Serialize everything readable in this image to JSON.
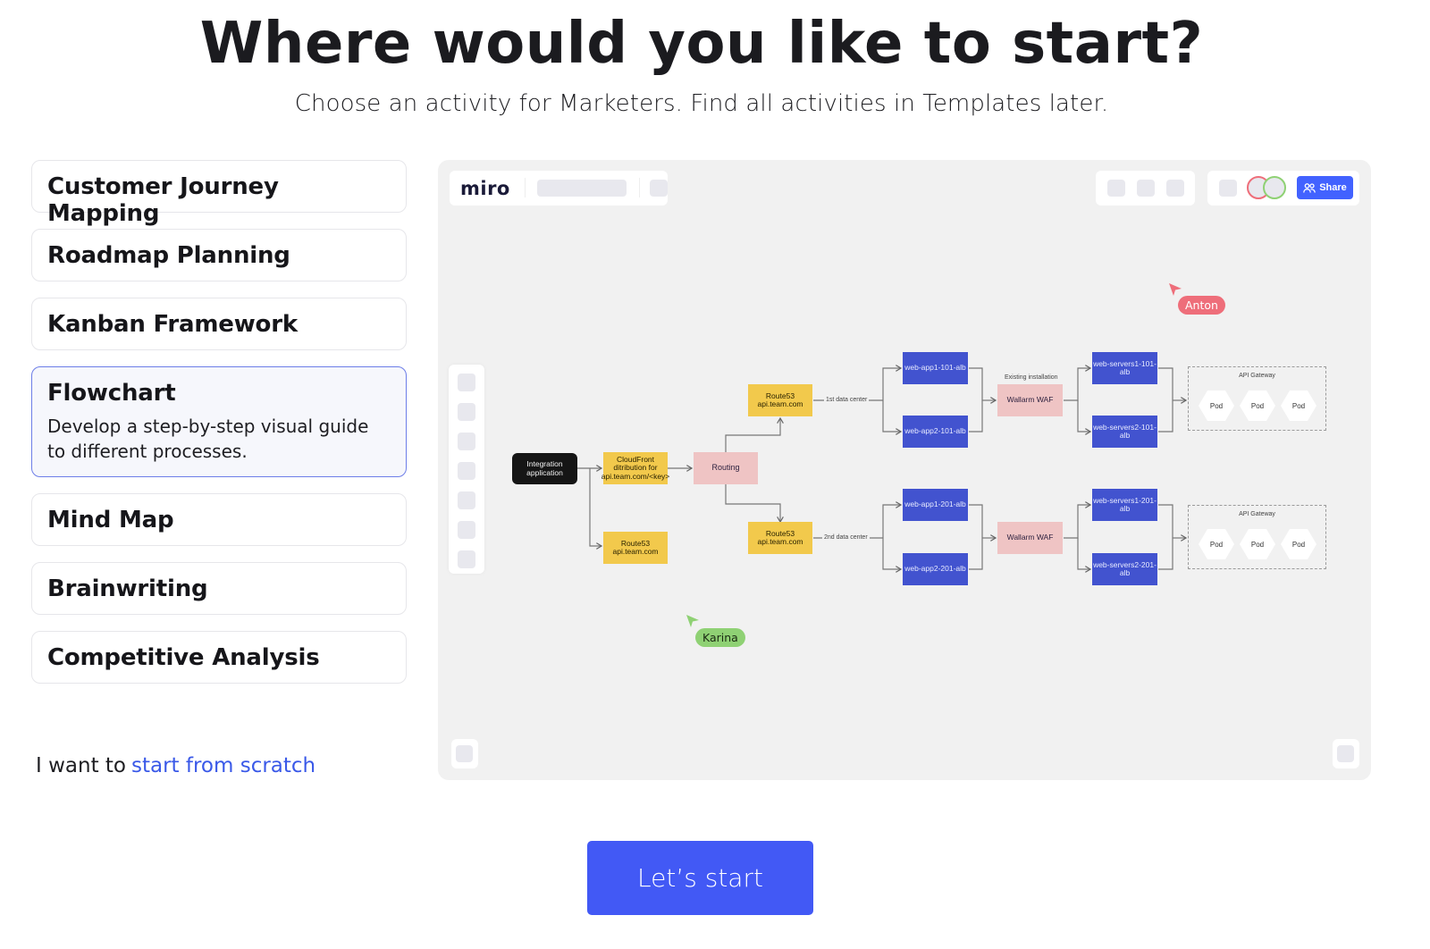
{
  "header": {
    "title": "Where would you like to start?",
    "subtitle": "Choose an activity for Marketers. Find all activities in Templates later."
  },
  "activities": [
    {
      "name": "Customer Journey Mapping",
      "selected": false
    },
    {
      "name": "Roadmap Planning",
      "selected": false
    },
    {
      "name": "Kanban Framework",
      "selected": false
    },
    {
      "name": "Flowchart",
      "selected": true,
      "description": "Develop a step-by-step visual guide to different processes."
    },
    {
      "name": "Mind Map",
      "selected": false
    },
    {
      "name": "Brainwriting",
      "selected": false
    },
    {
      "name": "Competitive Analysis",
      "selected": false
    }
  ],
  "scratch": {
    "prefix": "I want to",
    "link": "start from scratch"
  },
  "preview": {
    "logo": "miro",
    "share_label": "Share",
    "cursors": [
      {
        "name": "Anton",
        "color": "#ee6e7a"
      },
      {
        "name": "Karina",
        "color": "#8fd174"
      }
    ],
    "diagram": {
      "integration": "Integration application",
      "cloudfront": "CloudFront ditribution for api.team.com/<key>",
      "route53_main": "Route53 api.team.com",
      "routing": "Routing",
      "route53_dc1": "Route53 api.team.com",
      "route53_dc2": "Route53 api.team.com",
      "dc1_label": "1st data center",
      "dc2_label": "2nd data center",
      "webapp1_101": "web-app1-101-alb",
      "webapp2_101": "web-app2-101-alb",
      "webapp1_201": "web-app1-201-alb",
      "webapp2_201": "web-app2-201-alb",
      "existing_label": "Existing installation",
      "waf1": "Wallarm WAF",
      "waf2": "Wallarm WAF",
      "ws1_101": "web-servers1-101-alb",
      "ws2_101": "web-servers2-101-alb",
      "ws1_201": "web-servers1-201-alb",
      "ws2_201": "web-servers2-201-alb",
      "gateway_label": "API Gateway",
      "pod": "Pod"
    }
  },
  "cta": {
    "start_label": "Let’s start"
  }
}
